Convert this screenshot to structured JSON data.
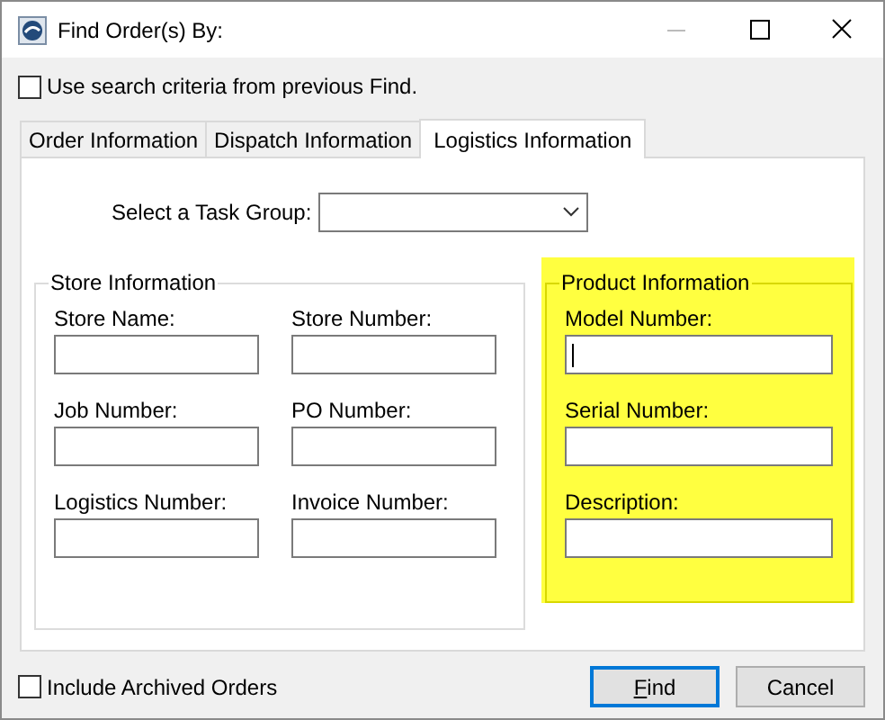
{
  "window": {
    "title": "Find Order(s) By:"
  },
  "use_previous_criteria": {
    "label": "Use search criteria from previous Find.",
    "checked": false
  },
  "tabs": [
    {
      "label": "Order Information",
      "selected": false
    },
    {
      "label": "Dispatch Information",
      "selected": false
    },
    {
      "label": "Logistics Information",
      "selected": true
    }
  ],
  "task_group": {
    "label": "Select a Task Group:"
  },
  "store_information": {
    "title": "Store Information",
    "fields": [
      {
        "label": "Store Name:",
        "focused": false
      },
      {
        "label": "Store Number:",
        "focused": false
      },
      {
        "label": "Job Number:",
        "focused": false
      },
      {
        "label": "PO Number:",
        "focused": false
      },
      {
        "label": "Logistics Number:",
        "focused": false
      },
      {
        "label": "Invoice Number:",
        "focused": false
      }
    ]
  },
  "product_information": {
    "title": "Product Information",
    "highlighted": true,
    "fields": [
      {
        "label": "Model Number:",
        "focused": true
      },
      {
        "label": "Serial Number:",
        "focused": false
      },
      {
        "label": "Description:",
        "focused": false
      }
    ]
  },
  "include_archived": {
    "label": "Include Archived Orders",
    "checked": false
  },
  "buttons": [
    {
      "label": "Find",
      "default": true,
      "first_letter_underlined": true
    },
    {
      "label": "Cancel",
      "default": false
    }
  ]
}
